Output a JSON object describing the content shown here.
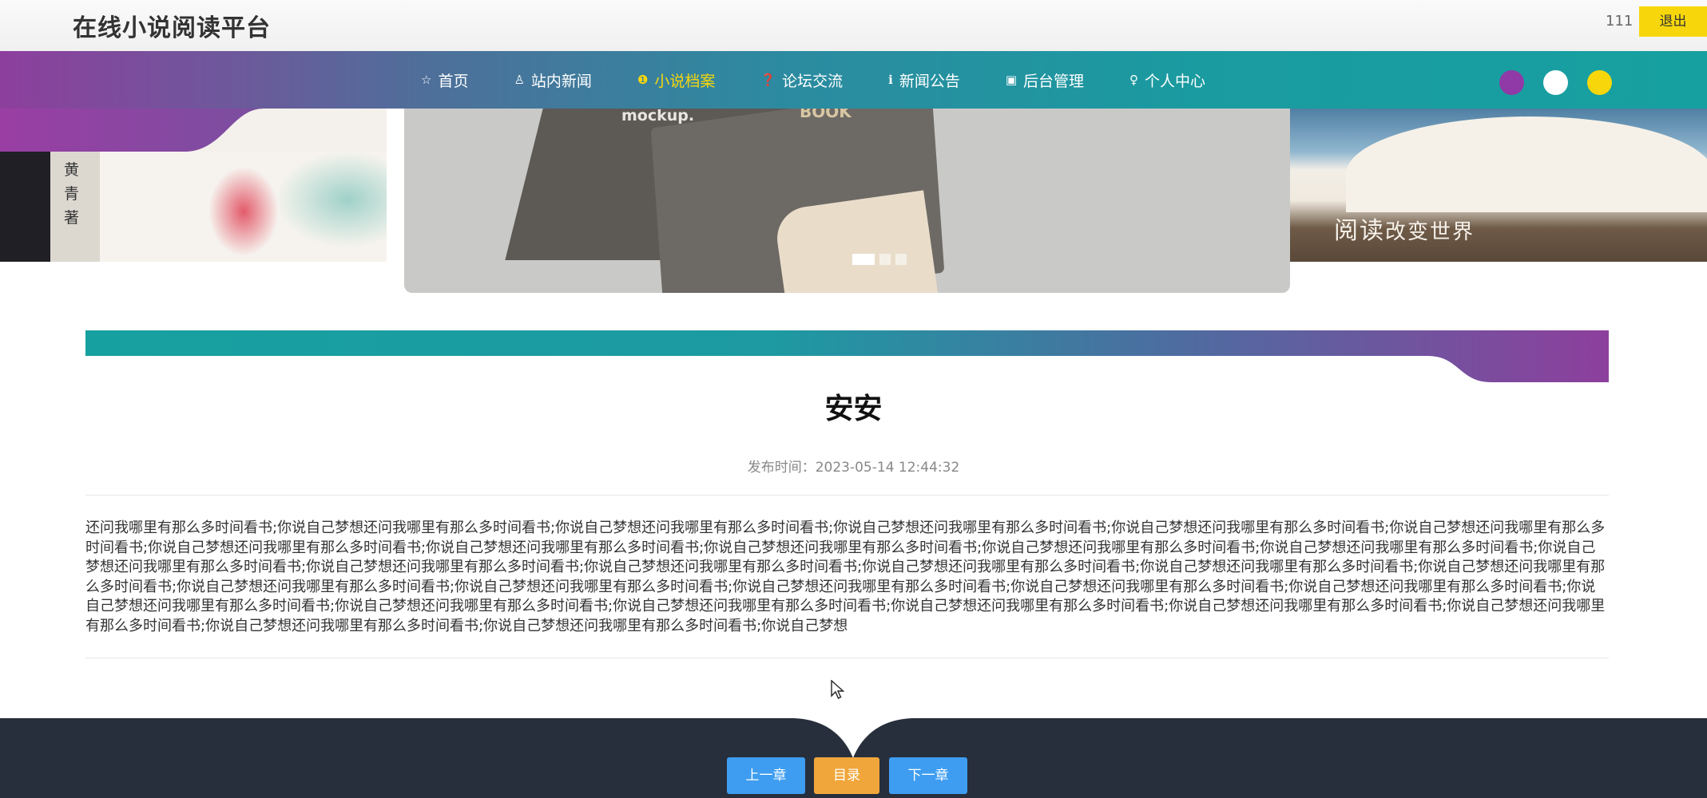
{
  "header": {
    "brand": "在线小说阅读平台",
    "username": "111",
    "logout_label": "退出"
  },
  "nav": {
    "items": [
      {
        "icon": "star-icon",
        "glyph": "☆",
        "label": "首页",
        "active": false
      },
      {
        "icon": "bag-icon",
        "glyph": "♙",
        "label": "站内新闻",
        "active": false
      },
      {
        "icon": "alert-icon",
        "glyph": "❶",
        "label": "小说档案",
        "active": true
      },
      {
        "icon": "question-icon",
        "glyph": "❓",
        "label": "论坛交流",
        "active": false
      },
      {
        "icon": "info-icon",
        "glyph": "ℹ",
        "label": "新闻公告",
        "active": false
      },
      {
        "icon": "gift-icon",
        "glyph": "▣",
        "label": "后台管理",
        "active": false
      },
      {
        "icon": "user-icon",
        "glyph": "♀",
        "label": "个人中心",
        "active": false
      }
    ],
    "theme_colors": [
      "#8f3aa6",
      "#ffffff",
      "#f7d70c"
    ]
  },
  "banner": {
    "left_text": "黄青著",
    "center_text_1": "mockup.",
    "center_text_2": "BOOK",
    "right_text": "阅读",
    "right_text_2": "改变世界",
    "active_slide": 1,
    "slide_count": 3
  },
  "article": {
    "title": "安安",
    "publish_label": "发布时间：",
    "publish_time": "2023-05-14 12:44:32",
    "content": "还问我哪里有那么多时间看书;你说自己梦想还问我哪里有那么多时间看书;你说自己梦想还问我哪里有那么多时间看书;你说自己梦想还问我哪里有那么多时间看书;你说自己梦想还问我哪里有那么多时间看书;你说自己梦想还问我哪里有那么多时间看书;你说自己梦想还问我哪里有那么多时间看书;你说自己梦想还问我哪里有那么多时间看书;你说自己梦想还问我哪里有那么多时间看书;你说自己梦想还问我哪里有那么多时间看书;你说自己梦想还问我哪里有那么多时间看书;你说自己梦想还问我哪里有那么多时间看书;你说自己梦想还问我哪里有那么多时间看书;你说自己梦想还问我哪里有那么多时间看书;你说自己梦想还问我哪里有那么多时间看书;你说自己梦想还问我哪里有那么多时间看书;你说自己梦想还问我哪里有那么多时间看书;你说自己梦想还问我哪里有那么多时间看书;你说自己梦想还问我哪里有那么多时间看书;你说自己梦想还问我哪里有那么多时间看书;你说自己梦想还问我哪里有那么多时间看书;你说自己梦想还问我哪里有那么多时间看书;你说自己梦想还问我哪里有那么多时间看书;你说自己梦想还问我哪里有那么多时间看书;你说自己梦想还问我哪里有那么多时间看书;你说自己梦想还问我哪里有那么多时间看书;你说自己梦想还问我哪里有那么多时间看书;你说自己梦想还问我哪里有那么多时间看书;你说自己梦想还问我哪里有那么多时间看书;你说自己梦想还问我哪里有那么多时间看书;你说自己梦想"
  },
  "footer": {
    "prev_label": "上一章",
    "toc_label": "目录",
    "next_label": "下一章"
  }
}
